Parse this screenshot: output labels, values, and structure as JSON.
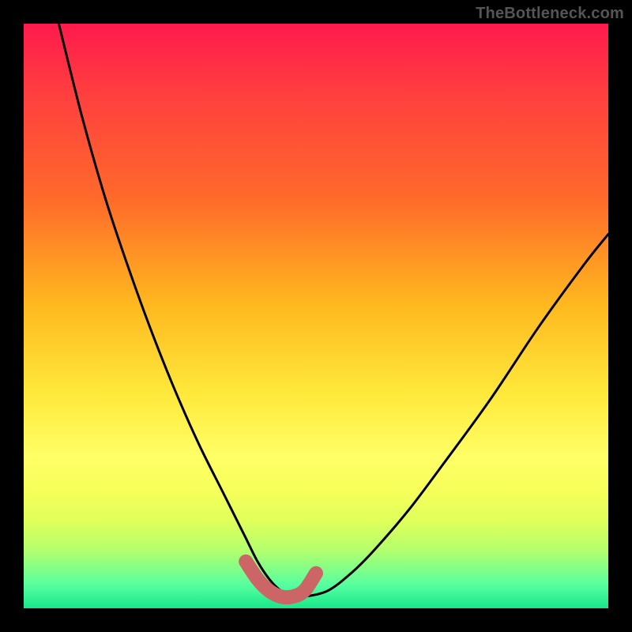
{
  "watermark": {
    "text": "TheBottleneck.com"
  },
  "chart_data": {
    "type": "line",
    "title": "",
    "xlabel": "",
    "ylabel": "",
    "xlim": [
      0,
      100
    ],
    "ylim": [
      0,
      100
    ],
    "series": [
      {
        "name": "bottleneck-curve",
        "x": [
          6,
          10,
          14,
          18,
          22,
          26,
          30,
          34,
          36,
          38,
          40,
          42,
          44,
          46,
          48,
          52,
          56,
          60,
          66,
          72,
          80,
          88,
          96,
          100
        ],
        "values": [
          100,
          84,
          70,
          58,
          47,
          37,
          28,
          20,
          16,
          12,
          8,
          5,
          3,
          2,
          2,
          3,
          6,
          10,
          17,
          25,
          36,
          48,
          59,
          64
        ]
      }
    ],
    "highlight": {
      "name": "optimal-range",
      "color": "#cc6666",
      "x": [
        38,
        40,
        42,
        44,
        46,
        48,
        50
      ],
      "values": [
        8,
        5,
        3,
        2,
        2,
        3,
        6
      ]
    }
  }
}
